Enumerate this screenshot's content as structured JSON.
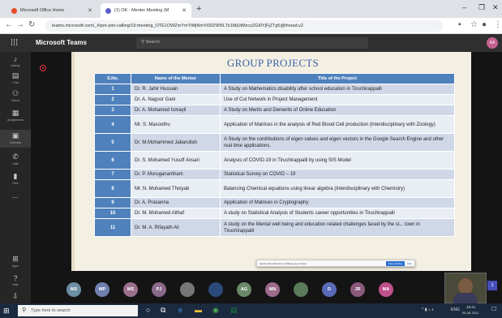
{
  "browser": {
    "tabs": [
      {
        "label": "Microsoft Office Home",
        "icon": "office-icon",
        "color": "#e8492b"
      },
      {
        "label": "(1) OK - Mentor Meeting (M",
        "icon": "teams-icon",
        "color": "#5b5fc7"
      }
    ],
    "url": "teams.microsoft.com/_#/pre-join-calling/19:meeting_OTE1OWZmYmYtMjNmYi00ZWI5LTk1MjUtMzczZGI0YjFjZTg5@thread.v2"
  },
  "teams": {
    "app_name": "Microsoft Teams",
    "search_placeholder": "Search",
    "profile_initials": "AA",
    "rail": [
      {
        "label": "Activity",
        "icon": "bell-icon"
      },
      {
        "label": "Chat",
        "icon": "chat-icon"
      },
      {
        "label": "Teams",
        "icon": "teams-icon"
      },
      {
        "label": "Assignments",
        "icon": "assignments-icon"
      },
      {
        "label": "Calendar",
        "icon": "calendar-icon"
      },
      {
        "label": "Calls",
        "icon": "phone-icon"
      },
      {
        "label": "Files",
        "icon": "files-icon"
      },
      {
        "label": "...",
        "icon": "more-icon"
      },
      {
        "label": "Apps",
        "icon": "apps-icon"
      },
      {
        "label": "Help",
        "icon": "help-icon"
      }
    ]
  },
  "slide": {
    "title": "GROUP PROJECTS",
    "headers": [
      "S.No.",
      "Name of the Mentor",
      "Title of the Project"
    ],
    "rows": [
      {
        "sno": "1",
        "mentor": "Dr. R. Jahir Hussain",
        "title": "A Study on Mathematics disability after school education in Tiruchirappalli"
      },
      {
        "sno": "2",
        "mentor": "Dr. A. Nagoor Gani",
        "title": "Use of Cut Network in Project Management"
      },
      {
        "sno": "3",
        "mentor": "Dr. A. Mohamed Ismayil",
        "title": "A Study on Merits and Demerits of Online Education"
      },
      {
        "sno": "4",
        "mentor": "Mr. S. Masoothu",
        "title": "Application of Matrices in the analysis of Red Blood Cell production (Interdisciplinary with Zoology)"
      },
      {
        "sno": "5",
        "mentor": "Dr. M.Mohammed Jabarullah",
        "title": "A Study on the contributions of eigen values and eigen vectors in the Google Search Engine and other real time applications."
      },
      {
        "sno": "6",
        "mentor": "Dr. S. Mohamed Yusuff Ansari",
        "title": "Analysis of COVID-19 in Tiruchirappalli by using SIS Model"
      },
      {
        "sno": "7",
        "mentor": "Dr. P. Muruganantham",
        "title": "Statistical Survey on COVID – 19"
      },
      {
        "sno": "8",
        "mentor": "Mr. N. Mohamed Thoiyab",
        "title": "Balancing Chemical equations using linear algebra (Interdisciplinary with Chemistry)"
      },
      {
        "sno": "9",
        "mentor": "Dr. A. Prasanna",
        "title": "Application of Matrices in Cryptography"
      },
      {
        "sno": "10",
        "mentor": "Dr. M. Mohamed Althaf",
        "title": "A study on Statistical Analysis of Students career opportunities in Tiruchirappalli"
      },
      {
        "sno": "11",
        "mentor": "Dr. M. A. Rifayath Ali",
        "title": "A study on the Mental well being and education related challenges faced by the st... lown in Tiruchirappalli"
      }
    ]
  },
  "share_notice": {
    "message": "teams.microsoft.com is sharing your screen.",
    "stop_label": "Stop sharing",
    "hide_label": "Hide"
  },
  "participants": [
    {
      "initials": "MS",
      "color": "#6c8ea3"
    },
    {
      "initials": "MP",
      "color": "#6f7fb0"
    },
    {
      "initials": "MS",
      "color": "#9c6f8c"
    },
    {
      "initials": "PJ",
      "color": "#8a6a8a"
    },
    {
      "initials": "",
      "color": "#777777"
    },
    {
      "initials": "",
      "color": "#2a4a7a"
    },
    {
      "initials": "AG",
      "color": "#6b8a6b"
    },
    {
      "initials": "MN",
      "color": "#9c6a8a"
    },
    {
      "initials": "",
      "color": "#5a7a5a"
    },
    {
      "initials": "D",
      "color": "#5a6ab8"
    },
    {
      "initials": "JR",
      "color": "#8a5a7a"
    },
    {
      "initials": "MA",
      "color": "#c0508a"
    }
  ],
  "participant_count": "1",
  "taskbar": {
    "search_placeholder": "Type here to search",
    "lang": "ENG",
    "time": "16:41",
    "date": "06-08-2021"
  },
  "colors": {
    "header_blue": "#4f81bd",
    "title_blue": "#3b60a8",
    "row_light": "#e9edf4",
    "row_dark": "#d0d8e8"
  }
}
